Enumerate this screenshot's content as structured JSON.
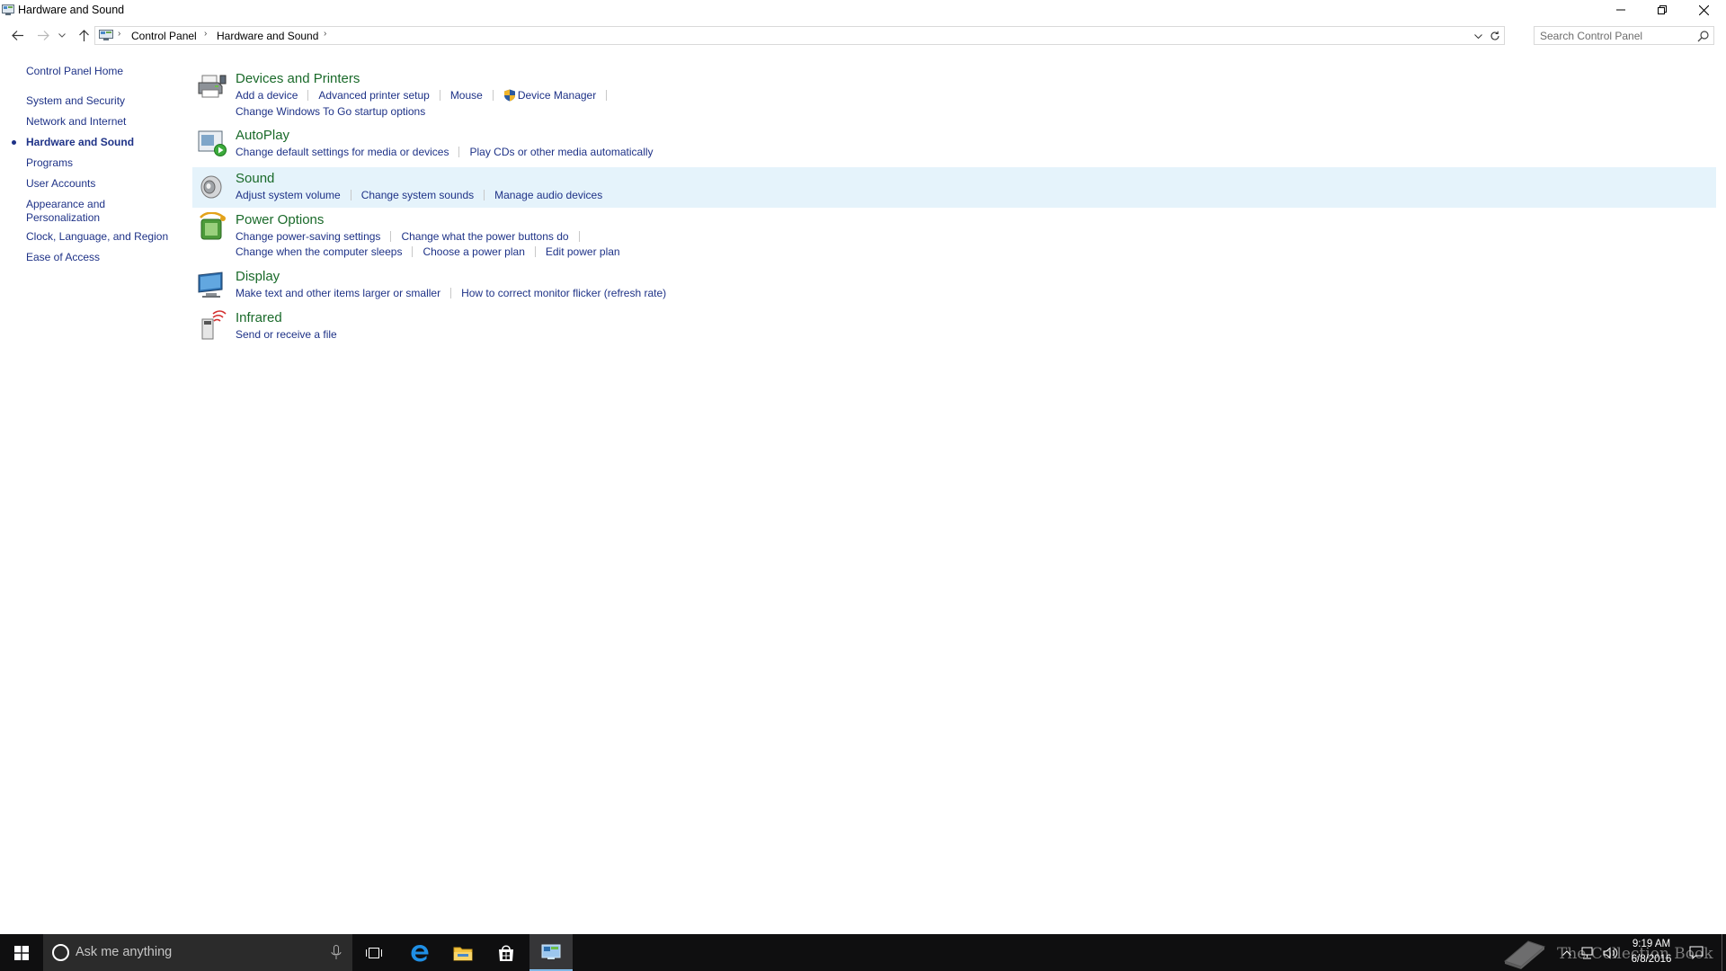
{
  "window": {
    "title": "Hardware and Sound"
  },
  "address": {
    "crumbs": [
      "Control Panel",
      "Hardware and Sound"
    ]
  },
  "search": {
    "placeholder": "Search Control Panel"
  },
  "sidebar": {
    "items": [
      {
        "label": "Control Panel Home"
      },
      {
        "label": "System and Security"
      },
      {
        "label": "Network and Internet"
      },
      {
        "label": "Hardware and Sound",
        "current": true
      },
      {
        "label": "Programs"
      },
      {
        "label": "User Accounts"
      },
      {
        "label": "Appearance and Personalization"
      },
      {
        "label": "Clock, Language, and Region"
      },
      {
        "label": "Ease of Access"
      }
    ]
  },
  "categories": [
    {
      "title": "Devices and Printers",
      "icon": "printer-icon",
      "rows": [
        [
          "Add a device",
          "Advanced printer setup",
          "Mouse",
          "Device Manager"
        ],
        [
          "Change Windows To Go startup options"
        ]
      ]
    },
    {
      "title": "AutoPlay",
      "icon": "autoplay-icon",
      "rows": [
        [
          "Change default settings for media or devices",
          "Play CDs or other media automatically"
        ]
      ]
    },
    {
      "title": "Sound",
      "icon": "speaker-icon",
      "rows": [
        [
          "Adjust system volume",
          "Change system sounds",
          "Manage audio devices"
        ]
      ]
    },
    {
      "title": "Power Options",
      "icon": "power-options-icon",
      "rows": [
        [
          "Change power-saving settings",
          "Change what the power buttons do"
        ],
        [
          "Change when the computer sleeps",
          "Choose a power plan",
          "Edit power plan"
        ]
      ]
    },
    {
      "title": "Display",
      "icon": "monitor-icon",
      "rows": [
        [
          "Make text and other items larger or smaller",
          "How to correct monitor flicker (refresh rate)"
        ]
      ]
    },
    {
      "title": "Infrared",
      "icon": "infrared-icon",
      "rows": [
        [
          "Send or receive a file"
        ]
      ]
    }
  ],
  "taskbar": {
    "search_placeholder": "Ask me anything",
    "clock_time": "9:19 AM",
    "clock_date": "6/8/2016",
    "watermark": "The Collection Book"
  },
  "colors": {
    "link": "#1e3287",
    "category_title": "#1a6a2a",
    "hover_row": "#e5f3fb",
    "taskbar": "#0f0f10"
  }
}
